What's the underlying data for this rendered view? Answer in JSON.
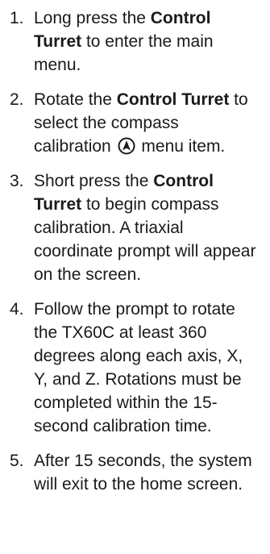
{
  "steps": [
    {
      "number": "1.",
      "text_before": "Long press the ",
      "bold": "Control Turret",
      "text_after": " to enter the main menu."
    },
    {
      "number": "2.",
      "text_before": "Rotate the ",
      "bold": "Control Turret",
      "text_mid": " to select the compass calibration ",
      "icon": "compass-icon",
      "text_after": " menu item."
    },
    {
      "number": "3.",
      "text_before": "Short press the ",
      "bold": "Control Turret",
      "text_after": " to begin compass calibration. A triaxial coordinate prompt will appear on the screen."
    },
    {
      "number": "4.",
      "text": "Follow the prompt to rotate the TX60C at least 360 degrees along each axis, X, Y, and Z. Rotations must be completed within the 15-second calibration time."
    },
    {
      "number": "5.",
      "text": "After 15 seconds, the system will exit to the home screen."
    }
  ],
  "colors": {
    "text": "#1a1a1a",
    "background": "#ffffff"
  }
}
